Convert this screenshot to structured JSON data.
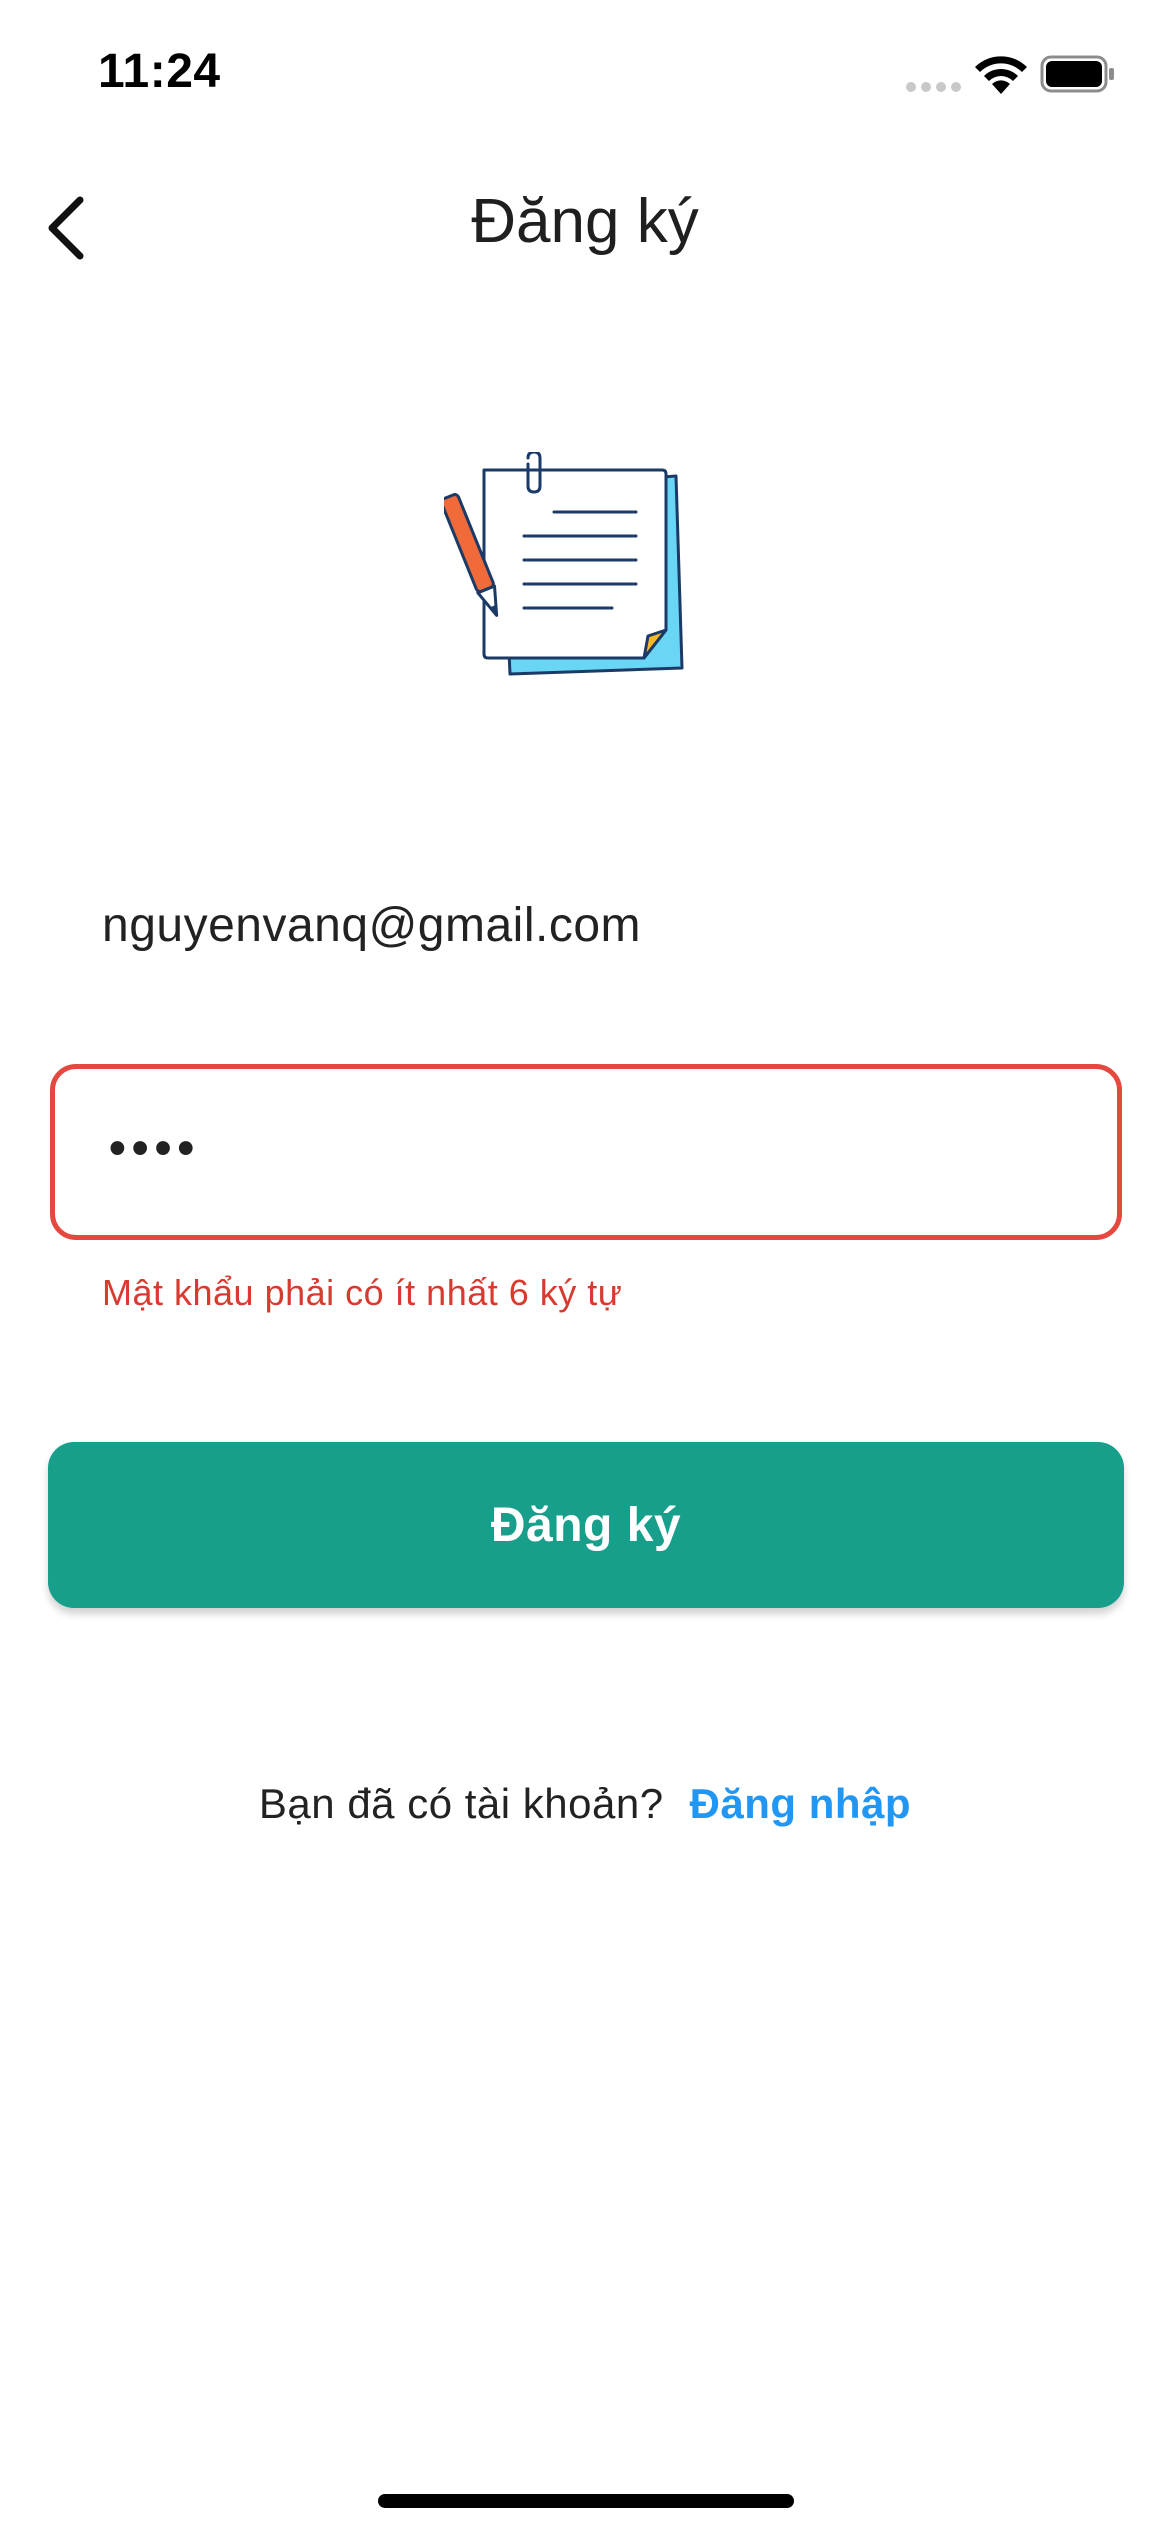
{
  "status_bar": {
    "time": "11:24"
  },
  "nav": {
    "title": "Đăng ký",
    "back_icon": "chevron-left-icon"
  },
  "illustration": {
    "icon": "notepad-pencil-icon",
    "colors": {
      "paper": "#ffffff",
      "back_sheet": "#6ad6f5",
      "outline": "#1b3a66",
      "pencil": "#f06a3a",
      "corner": "#f7b82a"
    }
  },
  "form": {
    "email_value": "nguyenvanq@gmail.com",
    "password_value": "••••",
    "password_error": "Mật khẩu phải có ít nhất 6 ký tự",
    "submit_label": "Đăng ký"
  },
  "footer": {
    "prompt": "Bạn đã có tài khoản?",
    "login_link": "Đăng nhập"
  },
  "colors": {
    "primary": "#179f8c",
    "error": "#e5483f",
    "link": "#2196f3"
  }
}
